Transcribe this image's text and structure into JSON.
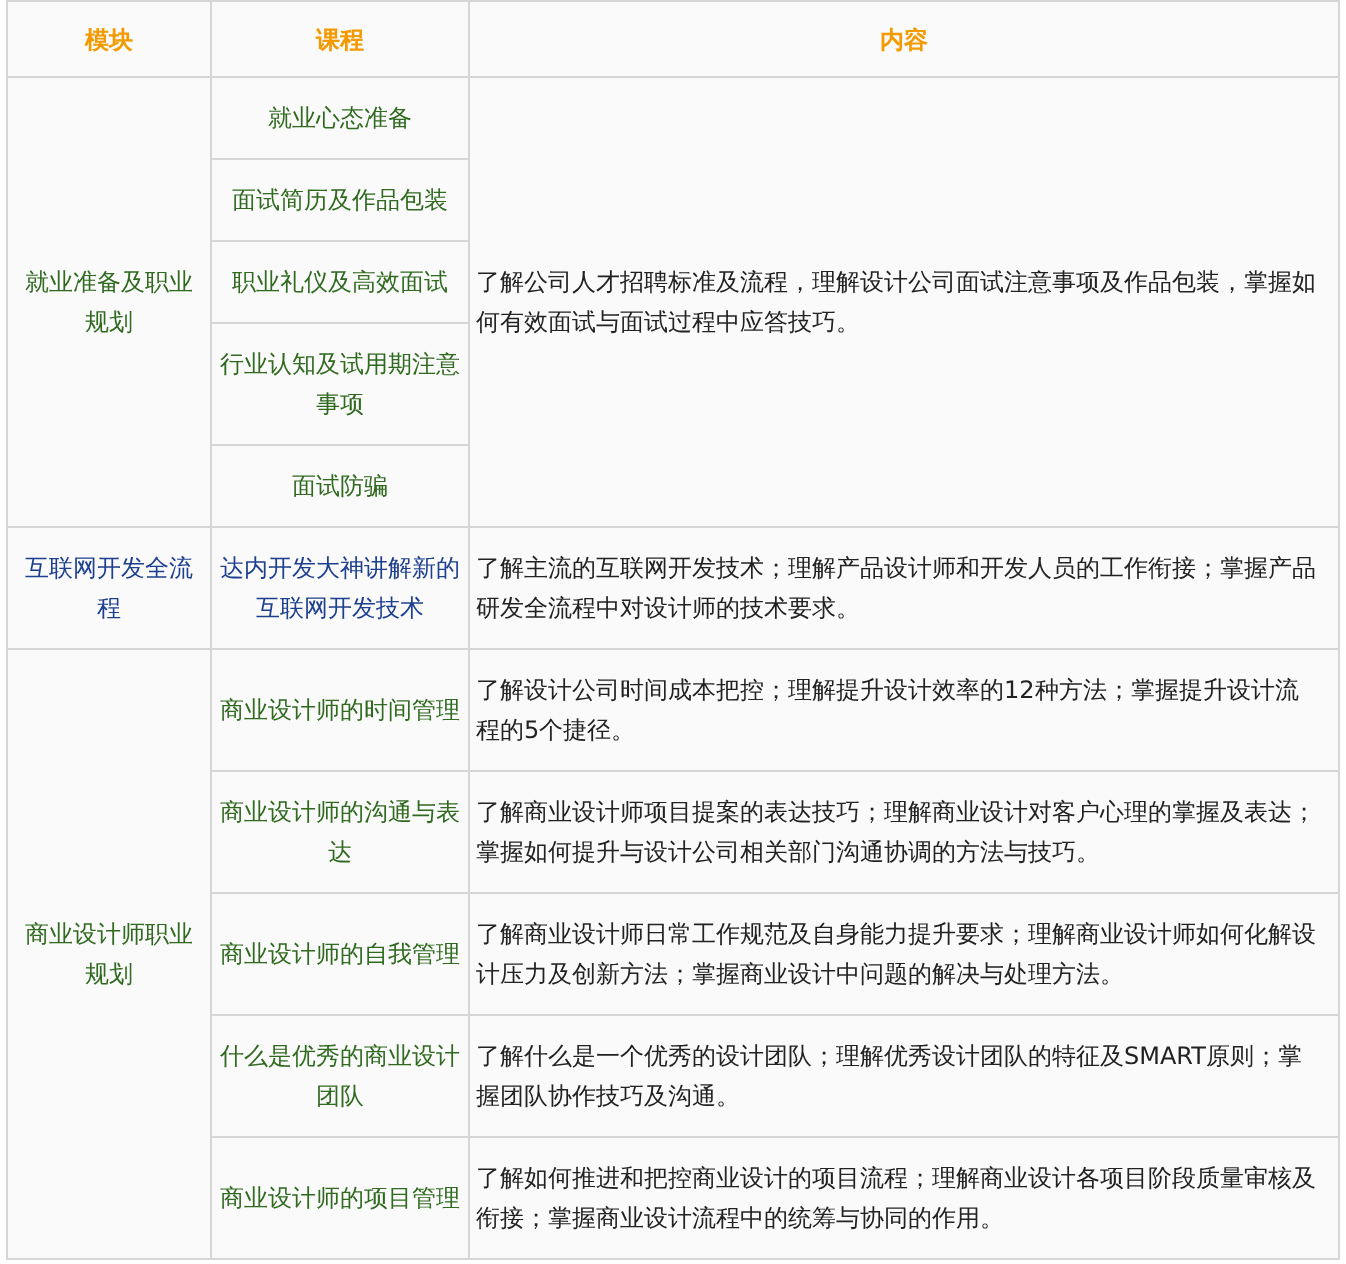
{
  "columns": [
    "模块",
    "课程",
    "内容"
  ],
  "groups": [
    {
      "module": "就业准备及职业规划",
      "color": "#2f6a1f",
      "content": "了解公司人才招聘标准及流程，理解设计公司面试注意事项及作品包装，掌握如何有效面试与面试过程中应答技巧。",
      "rows": [
        {
          "course": "就业心态准备"
        },
        {
          "course": "面试简历及作品包装"
        },
        {
          "course": "职业礼仪及高效面试"
        },
        {
          "course": "行业认知及试用期注意事项"
        },
        {
          "course": "面试防骗"
        }
      ]
    },
    {
      "module": "互联网开发全流程",
      "color": "#1d3f8f",
      "rows": [
        {
          "course": "达内开发大神讲解新的互联网开发技术",
          "content": "了解主流的互联网开发技术；理解产品设计师和开发人员的工作衔接；掌握产品研发全流程中对设计师的技术要求。"
        }
      ]
    },
    {
      "module": "商业设计师职业规划",
      "color": "#2f6a1f",
      "rows": [
        {
          "course": "商业设计师的时间管理",
          "content": "了解设计公司时间成本把控；理解提升设计效率的12种方法；掌握提升设计流程的5个捷径。"
        },
        {
          "course": "商业设计师的沟通与表达",
          "content": "了解商业设计师项目提案的表达技巧；理解商业设计对客户心理的掌握及表达；掌握如何提升与设计公司相关部门沟通协调的方法与技巧。"
        },
        {
          "course": "商业设计师的自我管理",
          "content": "了解商业设计师日常工作规范及自身能力提升要求；理解商业设计师如何化解设计压力及创新方法；掌握商业设计中问题的解决与处理方法。"
        },
        {
          "course": "什么是优秀的商业设计团队",
          "content": "了解什么是一个优秀的设计团队；理解优秀设计团队的特征及SMART原则；掌握团队协作技巧及沟通。"
        },
        {
          "course": "商业设计师的项目管理",
          "content": "了解如何推进和把控商业设计的项目流程；理解商业设计各项目阶段质量审核及衔接；掌握商业设计流程中的统筹与协同的作用。"
        }
      ]
    }
  ]
}
